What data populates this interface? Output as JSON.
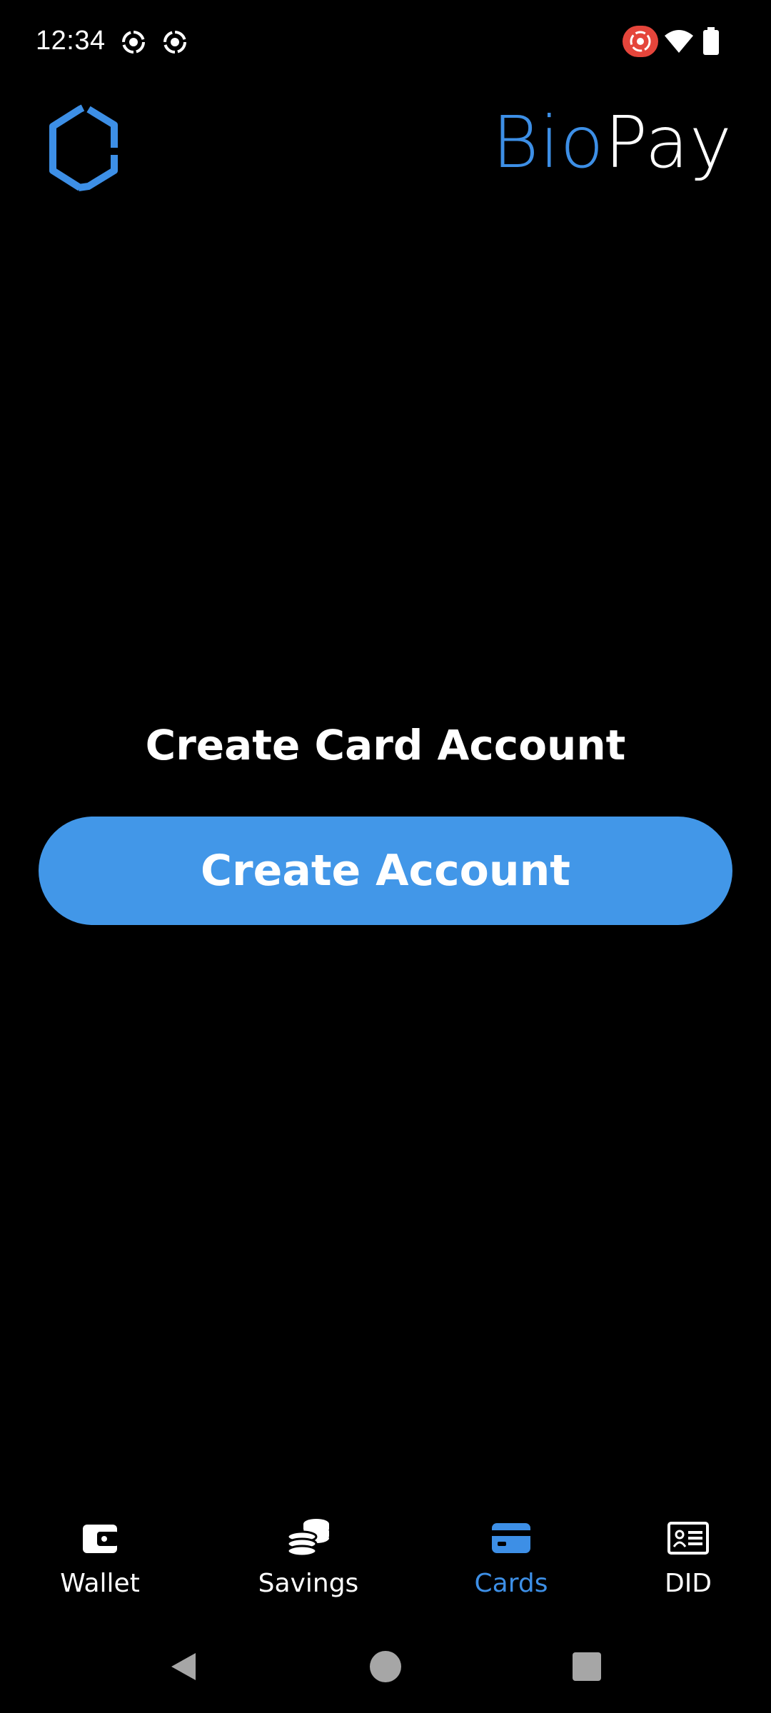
{
  "status_bar": {
    "time": "12:34",
    "left_icons": [
      "record-icon",
      "record-icon"
    ],
    "right_icons": [
      "screen-record-icon",
      "wifi-icon",
      "battery-icon"
    ]
  },
  "header": {
    "logo_icon": "hexagon-logo-icon",
    "brand_first": "Bio",
    "brand_second": "Pay"
  },
  "main": {
    "title": "Create Card Account",
    "button_label": "Create Account"
  },
  "bottom_nav": {
    "items": [
      {
        "label": "Wallet",
        "icon": "wallet-icon",
        "active": false
      },
      {
        "label": "Savings",
        "icon": "coins-icon",
        "active": false
      },
      {
        "label": "Cards",
        "icon": "credit-card-icon",
        "active": true
      },
      {
        "label": "DID",
        "icon": "id-card-icon",
        "active": false
      }
    ]
  },
  "system_nav": [
    "back-icon",
    "home-icon",
    "recents-icon"
  ],
  "colors": {
    "accent": "#3d8fe6",
    "button": "#4297e8",
    "background": "#000000",
    "text": "#ffffff"
  }
}
